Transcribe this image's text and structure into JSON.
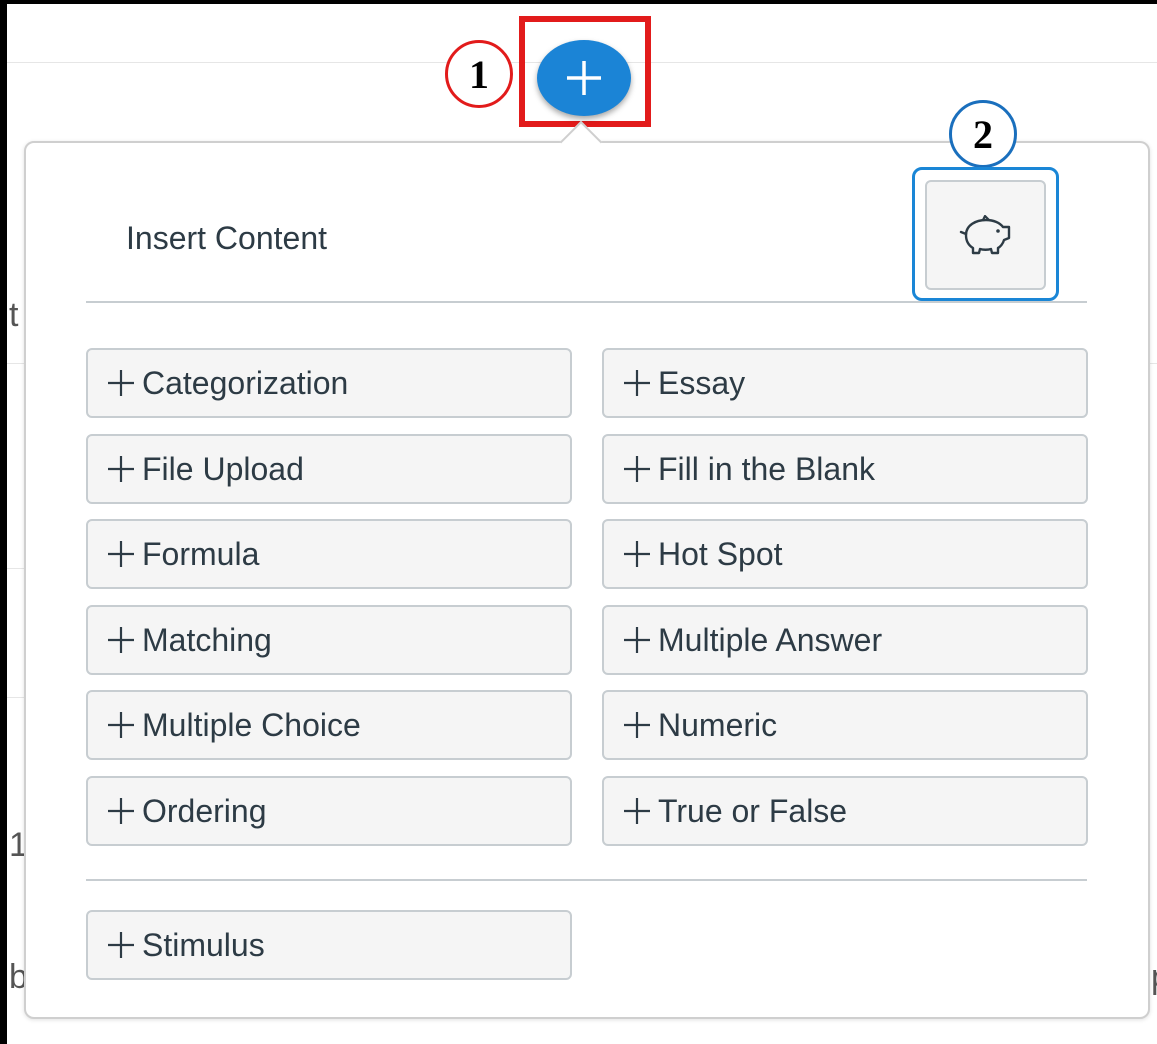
{
  "callouts": {
    "first": "1",
    "second": "2"
  },
  "popover": {
    "title": "Insert Content",
    "item_bank_icon": "piggy-bank-icon",
    "items": [
      {
        "label": "Categorization"
      },
      {
        "label": "Essay"
      },
      {
        "label": "File Upload"
      },
      {
        "label": "Fill in the Blank"
      },
      {
        "label": "Formula"
      },
      {
        "label": "Hot Spot"
      },
      {
        "label": "Matching"
      },
      {
        "label": "Multiple Answer"
      },
      {
        "label": "Multiple Choice"
      },
      {
        "label": "Numeric"
      },
      {
        "label": "Ordering"
      },
      {
        "label": "True or False"
      }
    ],
    "stimulus": {
      "label": "Stimulus"
    }
  },
  "background": {
    "chars": [
      "t",
      "1",
      "b",
      "p"
    ]
  },
  "colors": {
    "accent": "#1b84d6",
    "callout_red": "#e21b1b",
    "callout_blue": "#1a6fbd",
    "text": "#2d3b45",
    "button_bg": "#f5f5f5",
    "button_border": "#c7cdd1"
  }
}
